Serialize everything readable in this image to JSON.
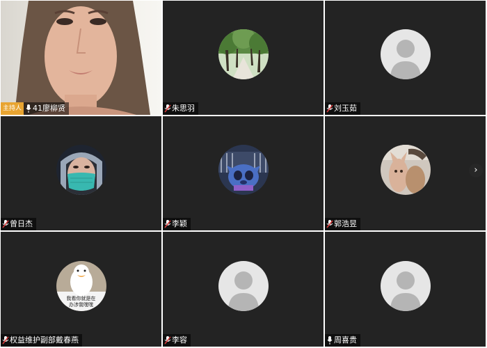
{
  "host_badge": "主持人",
  "participants": [
    {
      "name": "41廖柳贤"
    },
    {
      "name": "朱思羽"
    },
    {
      "name": "刘玉茹"
    },
    {
      "name": "曾日杰"
    },
    {
      "name": "李颖"
    },
    {
      "name": "郭浩昱"
    },
    {
      "name": "权益维护副部戴春燕"
    },
    {
      "name": "李容"
    },
    {
      "name": "周喜贵"
    }
  ],
  "duck_caption": [
    "我看你就是在",
    "办涉我嘿嘿"
  ],
  "icons": {
    "muted": "mic-muted-icon",
    "mic": "mic-icon",
    "next": "chevron-right-icon",
    "default_avatar": "default-avatar-icon"
  },
  "colors": {
    "tile_bg": "#232323",
    "host_badge": "#e8a431",
    "muted_mic": "#d63a3a"
  }
}
